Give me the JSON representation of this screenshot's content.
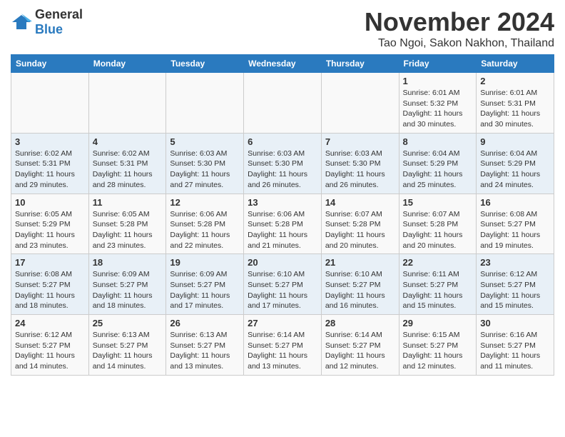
{
  "header": {
    "logo_general": "General",
    "logo_blue": "Blue",
    "month_title": "November 2024",
    "location": "Tao Ngoi, Sakon Nakhon, Thailand"
  },
  "weekdays": [
    "Sunday",
    "Monday",
    "Tuesday",
    "Wednesday",
    "Thursday",
    "Friday",
    "Saturday"
  ],
  "weeks": [
    [
      {
        "day": "",
        "info": ""
      },
      {
        "day": "",
        "info": ""
      },
      {
        "day": "",
        "info": ""
      },
      {
        "day": "",
        "info": ""
      },
      {
        "day": "",
        "info": ""
      },
      {
        "day": "1",
        "info": "Sunrise: 6:01 AM\nSunset: 5:32 PM\nDaylight: 11 hours and 30 minutes."
      },
      {
        "day": "2",
        "info": "Sunrise: 6:01 AM\nSunset: 5:31 PM\nDaylight: 11 hours and 30 minutes."
      }
    ],
    [
      {
        "day": "3",
        "info": "Sunrise: 6:02 AM\nSunset: 5:31 PM\nDaylight: 11 hours and 29 minutes."
      },
      {
        "day": "4",
        "info": "Sunrise: 6:02 AM\nSunset: 5:31 PM\nDaylight: 11 hours and 28 minutes."
      },
      {
        "day": "5",
        "info": "Sunrise: 6:03 AM\nSunset: 5:30 PM\nDaylight: 11 hours and 27 minutes."
      },
      {
        "day": "6",
        "info": "Sunrise: 6:03 AM\nSunset: 5:30 PM\nDaylight: 11 hours and 26 minutes."
      },
      {
        "day": "7",
        "info": "Sunrise: 6:03 AM\nSunset: 5:30 PM\nDaylight: 11 hours and 26 minutes."
      },
      {
        "day": "8",
        "info": "Sunrise: 6:04 AM\nSunset: 5:29 PM\nDaylight: 11 hours and 25 minutes."
      },
      {
        "day": "9",
        "info": "Sunrise: 6:04 AM\nSunset: 5:29 PM\nDaylight: 11 hours and 24 minutes."
      }
    ],
    [
      {
        "day": "10",
        "info": "Sunrise: 6:05 AM\nSunset: 5:29 PM\nDaylight: 11 hours and 23 minutes."
      },
      {
        "day": "11",
        "info": "Sunrise: 6:05 AM\nSunset: 5:28 PM\nDaylight: 11 hours and 23 minutes."
      },
      {
        "day": "12",
        "info": "Sunrise: 6:06 AM\nSunset: 5:28 PM\nDaylight: 11 hours and 22 minutes."
      },
      {
        "day": "13",
        "info": "Sunrise: 6:06 AM\nSunset: 5:28 PM\nDaylight: 11 hours and 21 minutes."
      },
      {
        "day": "14",
        "info": "Sunrise: 6:07 AM\nSunset: 5:28 PM\nDaylight: 11 hours and 20 minutes."
      },
      {
        "day": "15",
        "info": "Sunrise: 6:07 AM\nSunset: 5:28 PM\nDaylight: 11 hours and 20 minutes."
      },
      {
        "day": "16",
        "info": "Sunrise: 6:08 AM\nSunset: 5:27 PM\nDaylight: 11 hours and 19 minutes."
      }
    ],
    [
      {
        "day": "17",
        "info": "Sunrise: 6:08 AM\nSunset: 5:27 PM\nDaylight: 11 hours and 18 minutes."
      },
      {
        "day": "18",
        "info": "Sunrise: 6:09 AM\nSunset: 5:27 PM\nDaylight: 11 hours and 18 minutes."
      },
      {
        "day": "19",
        "info": "Sunrise: 6:09 AM\nSunset: 5:27 PM\nDaylight: 11 hours and 17 minutes."
      },
      {
        "day": "20",
        "info": "Sunrise: 6:10 AM\nSunset: 5:27 PM\nDaylight: 11 hours and 17 minutes."
      },
      {
        "day": "21",
        "info": "Sunrise: 6:10 AM\nSunset: 5:27 PM\nDaylight: 11 hours and 16 minutes."
      },
      {
        "day": "22",
        "info": "Sunrise: 6:11 AM\nSunset: 5:27 PM\nDaylight: 11 hours and 15 minutes."
      },
      {
        "day": "23",
        "info": "Sunrise: 6:12 AM\nSunset: 5:27 PM\nDaylight: 11 hours and 15 minutes."
      }
    ],
    [
      {
        "day": "24",
        "info": "Sunrise: 6:12 AM\nSunset: 5:27 PM\nDaylight: 11 hours and 14 minutes."
      },
      {
        "day": "25",
        "info": "Sunrise: 6:13 AM\nSunset: 5:27 PM\nDaylight: 11 hours and 14 minutes."
      },
      {
        "day": "26",
        "info": "Sunrise: 6:13 AM\nSunset: 5:27 PM\nDaylight: 11 hours and 13 minutes."
      },
      {
        "day": "27",
        "info": "Sunrise: 6:14 AM\nSunset: 5:27 PM\nDaylight: 11 hours and 13 minutes."
      },
      {
        "day": "28",
        "info": "Sunrise: 6:14 AM\nSunset: 5:27 PM\nDaylight: 11 hours and 12 minutes."
      },
      {
        "day": "29",
        "info": "Sunrise: 6:15 AM\nSunset: 5:27 PM\nDaylight: 11 hours and 12 minutes."
      },
      {
        "day": "30",
        "info": "Sunrise: 6:16 AM\nSunset: 5:27 PM\nDaylight: 11 hours and 11 minutes."
      }
    ]
  ]
}
